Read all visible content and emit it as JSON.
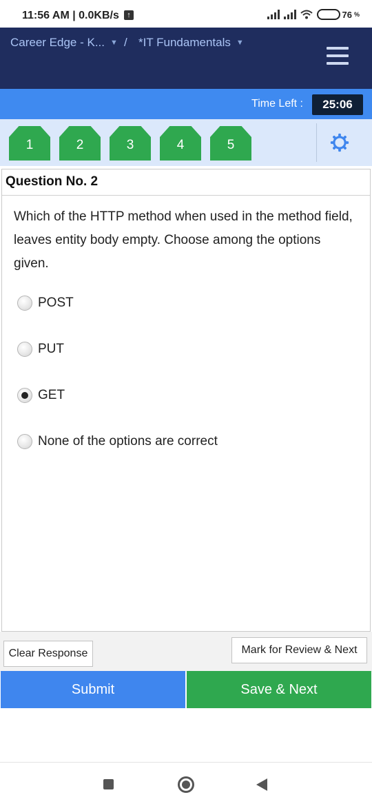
{
  "status_bar": {
    "time": "11:56 AM | 0.0KB/s",
    "upload_icon": "upload-arrow-icon",
    "battery": "76",
    "battery_unit": "%"
  },
  "header": {
    "breadcrumb_1": "Career Edge - K...",
    "separator": "/",
    "breadcrumb_2": "*IT Fundamentals",
    "menu_icon": "hamburger-menu-icon"
  },
  "timer": {
    "label": "Time Left :",
    "value": "25:06"
  },
  "question_nav": {
    "numbers": [
      "1",
      "2",
      "3",
      "4",
      "5"
    ],
    "settings_icon": "gear-icon"
  },
  "question": {
    "title": "Question No. 2",
    "text": "Which of the HTTP method when used in the method field, leaves entity body empty. Choose among the options given.",
    "options": [
      {
        "label": "POST",
        "selected": false
      },
      {
        "label": "PUT",
        "selected": false
      },
      {
        "label": "GET",
        "selected": true
      },
      {
        "label": "None of the options are correct",
        "selected": false
      }
    ]
  },
  "actions": {
    "clear": "Clear Response",
    "review": "Mark for Review & Next",
    "submit": "Submit",
    "save_next": "Save & Next"
  },
  "colors": {
    "header": "#1f2d5e",
    "timer_bar": "#3f8af0",
    "nav_strip": "#dbe8fb",
    "question_tab": "#2fa84f",
    "submit": "#3f86ee",
    "save_next": "#2fa84f"
  }
}
